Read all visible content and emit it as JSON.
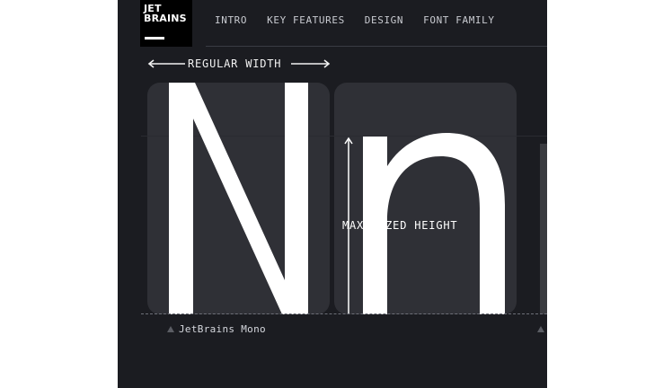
{
  "logo": {
    "line1": "JET",
    "line2": "BRAINS"
  },
  "nav": {
    "items": [
      "INTRO",
      "KEY FEATURES",
      "DESIGN",
      "FONT FAMILY"
    ]
  },
  "specimen": {
    "width_label": "REGULAR WIDTH",
    "height_label": "MAXIMIZED HEIGHT",
    "glyphs": "Nn",
    "font_name": "JetBrains Mono"
  },
  "colors": {
    "background": "#1b1c21",
    "glyph": "#ffffff",
    "card": "#2f3036",
    "accent_line": "#6d6f78"
  },
  "icons": [
    "arrow-left-icon",
    "arrow-right-icon",
    "arrow-up-icon",
    "triangle-marker-icon"
  ]
}
